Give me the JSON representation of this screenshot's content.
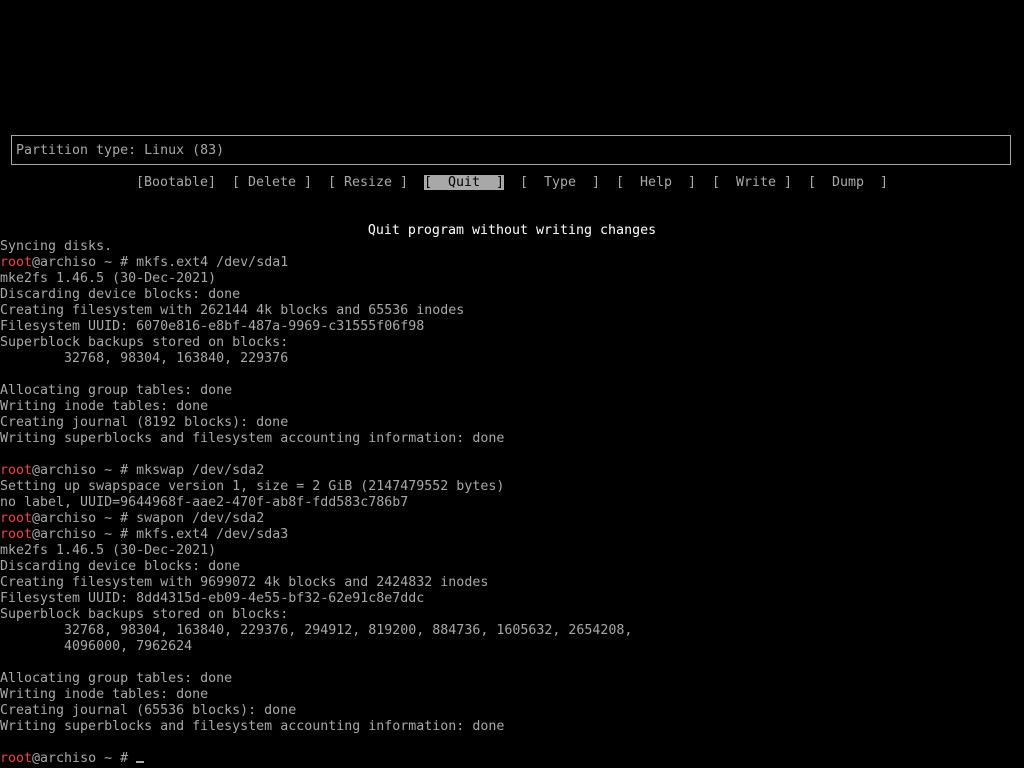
{
  "colors": {
    "background": "#000000",
    "text": "#a8a8a8",
    "highlight_text": "#ffffff",
    "prompt_user": "#ff3b3b",
    "selected_bg": "#a8a8a8"
  },
  "cfdisk": {
    "partition_type": "Partition type: Linux (83)",
    "menu": [
      {
        "label": "[Bootable]"
      },
      {
        "label": "[ Delete ]"
      },
      {
        "label": "[ Resize ]"
      },
      {
        "label": "[  Quit  ]",
        "selected": true
      },
      {
        "label": "[  Type  ]"
      },
      {
        "label": "[  Help  ]"
      },
      {
        "label": "[  Write ]"
      },
      {
        "label": "[  Dump  ]"
      }
    ],
    "description": "Quit program without writing changes"
  },
  "terminal": {
    "prompt_user": "root",
    "prompt_rest": "@archiso ~ # ",
    "lines": [
      {
        "text": "Syncing disks."
      },
      {
        "prompt": true,
        "text": "mkfs.ext4 /dev/sda1"
      },
      {
        "text": "mke2fs 1.46.5 (30-Dec-2021)"
      },
      {
        "text": "Discarding device blocks: done"
      },
      {
        "text": "Creating filesystem with 262144 4k blocks and 65536 inodes"
      },
      {
        "text": "Filesystem UUID: 6070e816-e8bf-487a-9969-c31555f06f98"
      },
      {
        "text": "Superblock backups stored on blocks:"
      },
      {
        "text": "        32768, 98304, 163840, 229376"
      },
      {
        "text": ""
      },
      {
        "text": "Allocating group tables: done"
      },
      {
        "text": "Writing inode tables: done"
      },
      {
        "text": "Creating journal (8192 blocks): done"
      },
      {
        "text": "Writing superblocks and filesystem accounting information: done"
      },
      {
        "text": ""
      },
      {
        "prompt": true,
        "text": "mkswap /dev/sda2"
      },
      {
        "text": "Setting up swapspace version 1, size = 2 GiB (2147479552 bytes)"
      },
      {
        "text": "no label, UUID=9644968f-aae2-470f-ab8f-fdd583c786b7"
      },
      {
        "prompt": true,
        "text": "swapon /dev/sda2"
      },
      {
        "prompt": true,
        "text": "mkfs.ext4 /dev/sda3"
      },
      {
        "text": "mke2fs 1.46.5 (30-Dec-2021)"
      },
      {
        "text": "Discarding device blocks: done"
      },
      {
        "text": "Creating filesystem with 9699072 4k blocks and 2424832 inodes"
      },
      {
        "text": "Filesystem UUID: 8dd4315d-eb09-4e55-bf32-62e91c8e7ddc"
      },
      {
        "text": "Superblock backups stored on blocks:"
      },
      {
        "text": "        32768, 98304, 163840, 229376, 294912, 819200, 884736, 1605632, 2654208,"
      },
      {
        "text": "        4096000, 7962624"
      },
      {
        "text": ""
      },
      {
        "text": "Allocating group tables: done"
      },
      {
        "text": "Writing inode tables: done"
      },
      {
        "text": "Creating journal (65536 blocks): done"
      },
      {
        "text": "Writing superblocks and filesystem accounting information: done"
      },
      {
        "text": ""
      },
      {
        "prompt": true,
        "text": "",
        "cursor": true
      }
    ]
  }
}
